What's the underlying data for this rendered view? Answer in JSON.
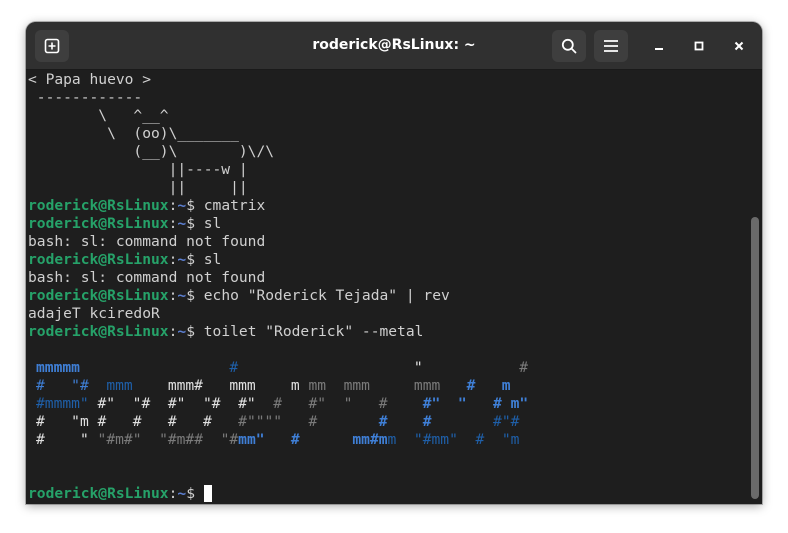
{
  "window": {
    "title": "roderick@RsLinux: ~",
    "buttons": {
      "new_tab": "new-tab-icon",
      "search": "search-icon",
      "menu": "hamburger-menu-icon",
      "minimize": "minimize-icon",
      "maximize": "maximize-icon",
      "close": "close-icon"
    }
  },
  "prompt": {
    "user_host": "roderick@RsLinux",
    "sep": ":",
    "path": "~",
    "symbol": "$ "
  },
  "cowsay": [
    "< Papa huevo >",
    " ------------",
    "        \\   ^__^",
    "         \\  (oo)\\_______",
    "            (__)\\       )\\/\\",
    "                ||----w |",
    "                ||     ||"
  ],
  "commands": [
    {
      "cmd": "cmatrix",
      "output": []
    },
    {
      "cmd": "sl",
      "output": [
        "bash: sl: command not found"
      ]
    },
    {
      "cmd": "sl",
      "output": [
        "bash: sl: command not found"
      ]
    },
    {
      "cmd": "echo \"Roderick Tejada\" | rev",
      "output": [
        "adajeT kciredoR"
      ]
    },
    {
      "cmd": "toilet \"Roderick\" --metal",
      "output": []
    }
  ],
  "toilet_banner": [
    [
      [
        "mmmmm",
        "#3f7fd6",
        true
      ],
      [
        "                 ",
        "#ffffff",
        false
      ],
      [
        "#",
        "#1f5fa8",
        false
      ],
      [
        "                    ",
        "#ffffff",
        false
      ],
      [
        "\"",
        "#e0e0e0",
        false
      ],
      [
        "           ",
        "#ffffff",
        false
      ],
      [
        "#",
        "#7a7a7a",
        false
      ]
    ],
    [
      [
        "#",
        "#3f7fd6",
        false
      ],
      [
        "   ",
        "#ffffff",
        false
      ],
      [
        "\"#",
        "#3f7fd6",
        false
      ],
      [
        "  ",
        "#ffffff",
        false
      ],
      [
        "mmm",
        "#1f5fa8",
        false
      ],
      [
        "    ",
        "#ffffff",
        false
      ],
      [
        "mmm#",
        "#e0e0e0",
        false
      ],
      [
        "   ",
        "#ffffff",
        false
      ],
      [
        "mmm",
        "#e0e0e0",
        false
      ],
      [
        "    ",
        "#ffffff",
        false
      ],
      [
        "m",
        "#e0e0e0",
        false
      ],
      [
        " ",
        "#ffffff",
        false
      ],
      [
        "mm",
        "#7a7a7a",
        false
      ],
      [
        "  ",
        "#ffffff",
        false
      ],
      [
        "mmm",
        "#7a7a7a",
        false
      ],
      [
        "     ",
        "#ffffff",
        false
      ],
      [
        "mmm",
        "#7a7a7a",
        false
      ],
      [
        "   ",
        "#ffffff",
        false
      ],
      [
        "#",
        "#3f7fd6",
        true
      ],
      [
        "   ",
        "#ffffff",
        false
      ],
      [
        "m",
        "#3f7fd6",
        true
      ]
    ],
    [
      [
        "#mmmm\"",
        "#1f5fa8",
        false
      ],
      [
        " ",
        "#ffffff",
        false
      ],
      [
        "#\"",
        "#e0e0e0",
        false
      ],
      [
        "  ",
        "#ffffff",
        false
      ],
      [
        "\"#",
        "#e0e0e0",
        false
      ],
      [
        "  ",
        "#ffffff",
        false
      ],
      [
        "#\"",
        "#e0e0e0",
        false
      ],
      [
        "  ",
        "#ffffff",
        false
      ],
      [
        "\"#",
        "#e0e0e0",
        false
      ],
      [
        "  ",
        "#ffffff",
        false
      ],
      [
        "#\"",
        "#e0e0e0",
        false
      ],
      [
        "  ",
        "#ffffff",
        false
      ],
      [
        "#",
        "#7a7a7a",
        false
      ],
      [
        "   ",
        "#ffffff",
        false
      ],
      [
        "#\"",
        "#7a7a7a",
        false
      ],
      [
        "  ",
        "#ffffff",
        false
      ],
      [
        "\"",
        "#7a7a7a",
        false
      ],
      [
        "   ",
        "#ffffff",
        false
      ],
      [
        "#",
        "#7a7a7a",
        false
      ],
      [
        "    ",
        "#ffffff",
        false
      ],
      [
        "#\"",
        "#3f7fd6",
        true
      ],
      [
        "  ",
        "#ffffff",
        false
      ],
      [
        "\"",
        "#3f7fd6",
        true
      ],
      [
        "   ",
        "#ffffff",
        false
      ],
      [
        "#",
        "#3f7fd6",
        true
      ],
      [
        " ",
        "#ffffff",
        false
      ],
      [
        "m\"",
        "#3f7fd6",
        true
      ]
    ],
    [
      [
        "#",
        "#e0e0e0",
        false
      ],
      [
        "   ",
        "#ffffff",
        false
      ],
      [
        "\"m",
        "#e0e0e0",
        false
      ],
      [
        " ",
        "#ffffff",
        false
      ],
      [
        "#",
        "#e0e0e0",
        false
      ],
      [
        "   ",
        "#ffffff",
        false
      ],
      [
        "#",
        "#e0e0e0",
        false
      ],
      [
        "   ",
        "#ffffff",
        false
      ],
      [
        "#",
        "#e0e0e0",
        false
      ],
      [
        "   ",
        "#ffffff",
        false
      ],
      [
        "#",
        "#e0e0e0",
        false
      ],
      [
        "   ",
        "#ffffff",
        false
      ],
      [
        "#\"\"\"\"",
        "#7a7a7a",
        false
      ],
      [
        "   ",
        "#ffffff",
        false
      ],
      [
        "#",
        "#7a7a7a",
        false
      ],
      [
        "       ",
        "#ffffff",
        false
      ],
      [
        "#",
        "#3f7fd6",
        true
      ],
      [
        "    ",
        "#ffffff",
        false
      ],
      [
        "#",
        "#3f7fd6",
        true
      ],
      [
        "       ",
        "#ffffff",
        false
      ],
      [
        "#\"#",
        "#1f5fa8",
        false
      ]
    ],
    [
      [
        "#",
        "#e0e0e0",
        false
      ],
      [
        "    ",
        "#ffffff",
        false
      ],
      [
        "\"",
        "#e0e0e0",
        false
      ],
      [
        " ",
        "#ffffff",
        false
      ],
      [
        "\"#m#\"",
        "#7a7a7a",
        false
      ],
      [
        "  ",
        "#ffffff",
        false
      ],
      [
        "\"#m##",
        "#7a7a7a",
        false
      ],
      [
        "  ",
        "#ffffff",
        false
      ],
      [
        "\"#",
        "#7a7a7a",
        false
      ],
      [
        "mm\"",
        "#3f7fd6",
        true
      ],
      [
        "   ",
        "#ffffff",
        false
      ],
      [
        "#",
        "#3f7fd6",
        true
      ],
      [
        "      ",
        "#ffffff",
        false
      ],
      [
        "mm#m",
        "#3f7fd6",
        true
      ],
      [
        "m",
        "#1f5fa8",
        false
      ],
      [
        "  ",
        "#ffffff",
        false
      ],
      [
        "\"#mm\"",
        "#1f5fa8",
        false
      ],
      [
        "  ",
        "#ffffff",
        false
      ],
      [
        "#",
        "#1f5fa8",
        false
      ],
      [
        "  ",
        "#ffffff",
        false
      ],
      [
        "\"m",
        "#1f5fa8",
        false
      ]
    ]
  ]
}
